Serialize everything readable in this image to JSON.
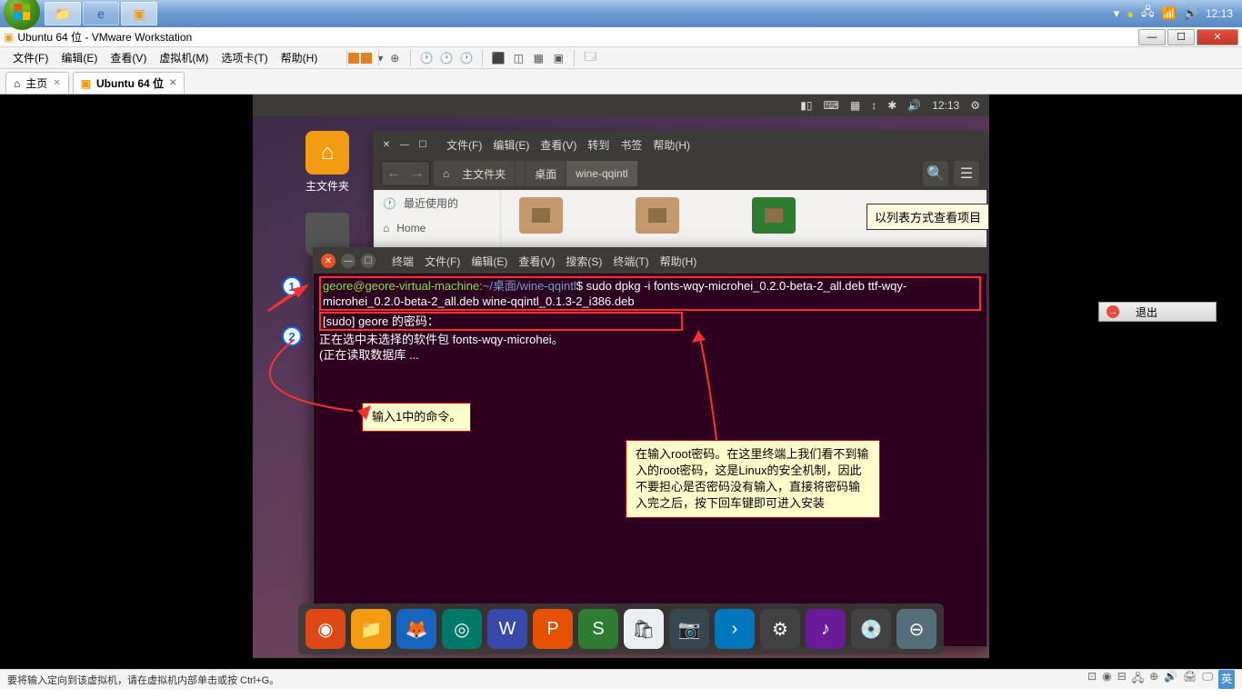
{
  "taskbar": {
    "clock": "12:13",
    "tray_icons": [
      "▾",
      "●",
      "📶",
      "📶",
      "🔊"
    ]
  },
  "vmware": {
    "title": "Ubuntu 64 位 - VMware Workstation",
    "menu": [
      "文件(F)",
      "编辑(E)",
      "查看(V)",
      "虚拟机(M)",
      "选项卡(T)",
      "帮助(H)"
    ],
    "tabs": {
      "home": "主页",
      "vm": "Ubuntu 64 位"
    },
    "status": "要将输入定向到该虚拟机，请在虚拟机内部单击或按 Ctrl+G。"
  },
  "ubuntu_panel": {
    "time": "12:13"
  },
  "desktop": {
    "home_label": "主文件夹"
  },
  "nautilus": {
    "menu": [
      "文件(F)",
      "编辑(E)",
      "查看(V)",
      "转到",
      "书签",
      "帮助(H)"
    ],
    "crumb": {
      "home": "主文件夹",
      "desktop": "桌面",
      "folder": "wine-qqintl"
    },
    "sidebar": {
      "recent": "最近使用的",
      "home": "Home"
    }
  },
  "tooltip": "以列表方式查看项目",
  "terminal": {
    "title_menu": [
      "终端",
      "文件(F)",
      "编辑(E)",
      "查看(V)",
      "搜索(S)",
      "终端(T)",
      "帮助(H)"
    ],
    "prompt_user": "geore@geore-virtual-machine",
    "prompt_path": "~/桌面/wine-qqintl",
    "cmd": "sudo dpkg -i fonts-wqy-microhei_0.2.0-beta-2_all.deb ttf-wqy-microhei_0.2.0-beta-2_all.deb wine-qqintl_0.1.3-2_i386.deb",
    "line2": "[sudo] geore 的密码：",
    "line3": "正在选中未选择的软件包 fonts-wqy-microhei。",
    "line4": "(正在读取数据库 ..."
  },
  "annotations": {
    "num1": "1",
    "num2": "2",
    "note1": "输入1中的命令。",
    "note2": "在输入root密码。在这里终端上我们看不到输入的root密码，这是Linux的安全机制，因此不要担心是否密码没有输入，直接将密码输入完之后，按下回车键即可进入安装"
  },
  "exit_button": "退出",
  "ime_badge": "英"
}
